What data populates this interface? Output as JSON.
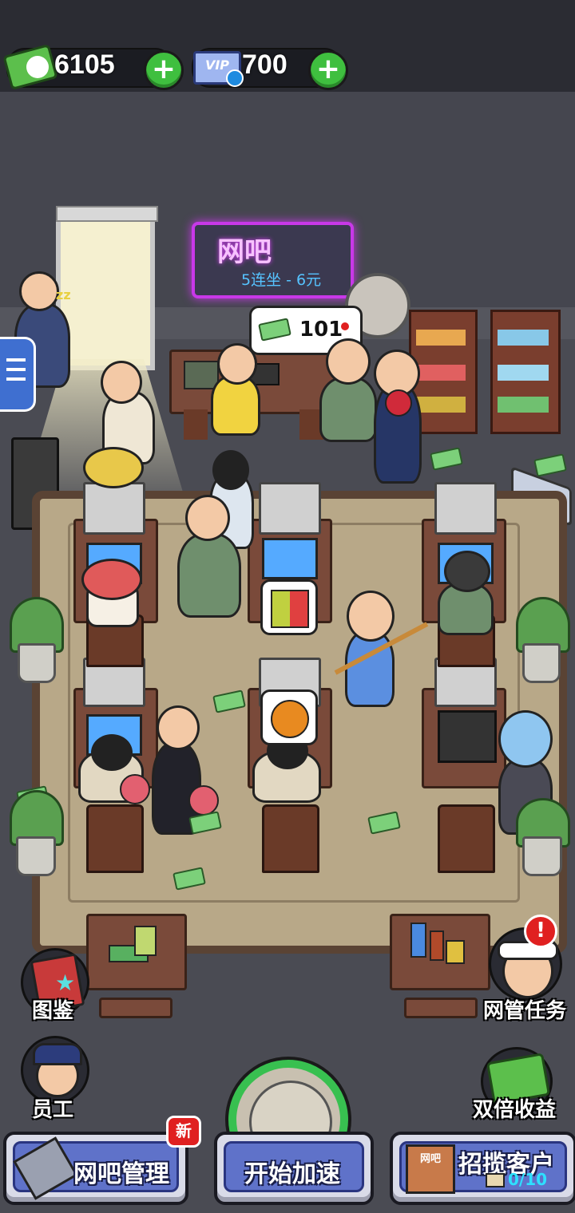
{
  "hud": {
    "cash_value": "6105",
    "vip_badge": "VIP",
    "vip_value": "700",
    "add_symbol": "+"
  },
  "sign": {
    "title": "网吧",
    "subtitle": "5连坐 - 6元"
  },
  "counter": {
    "income_value": "101"
  },
  "side_buttons": {
    "catalog_label": "图鉴",
    "staff_label": "员工",
    "admin_tasks_label": "网管任务",
    "double_income_label": "双倍收益",
    "alert_symbol": "!"
  },
  "bottom_bar": {
    "manage_label": "网吧管理",
    "new_badge": "新",
    "speed_up_label": "开始加速",
    "recruit_label": "招揽客户",
    "recruit_shop_sign": "网吧",
    "recruit_progress": "0/10"
  },
  "colors": {
    "accent_green": "#3fbf3f",
    "neon_purple": "#c838e8",
    "button_blue": "#5f72c9",
    "alert_red": "#e02020"
  },
  "icons": [
    "cash-icon",
    "vip-ticket-icon",
    "plus-icon",
    "menu-list-icon",
    "book-icon",
    "police-avatar-icon",
    "admin-girl-icon",
    "money-stack-icon",
    "tools-icon",
    "shop-icon",
    "speed-gauge-icon"
  ]
}
